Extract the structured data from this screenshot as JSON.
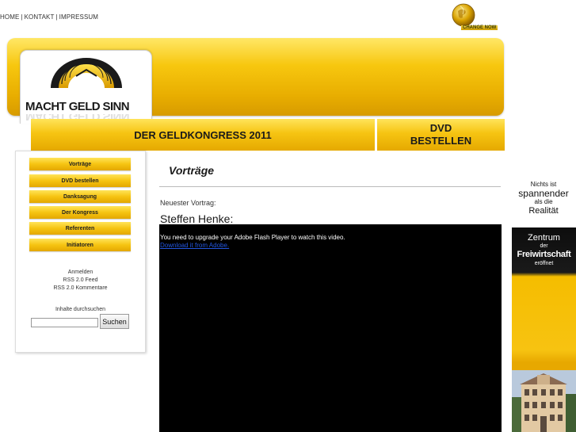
{
  "top_nav": {
    "items": [
      "HOME",
      "KONTAKT",
      "IMPRESSUM"
    ],
    "separator": "|"
  },
  "partner_logo": {
    "text": "CHANGE NOW",
    "icon": "globe-icon"
  },
  "site_logo": {
    "text": "MACHT GELD SINN",
    "icon": "rising-sun-logo-icon"
  },
  "header_bars": {
    "title": "DER GELDKONGRESS 2011",
    "dvd_line1": "DVD",
    "dvd_line2": "BESTELLEN"
  },
  "sidebar": {
    "menu": [
      "Vorträge",
      "DVD bestellen",
      "Danksagung",
      "Der Kongress",
      "Referenten",
      "Initiatoren"
    ],
    "links": [
      "Anmelden",
      "RSS 2.0 Feed",
      "RSS 2.0 Kommentare"
    ],
    "search_label": "Inhalte durchsuchen",
    "search_value": "",
    "search_button": "Suchen"
  },
  "content": {
    "title": "Vorträge",
    "latest_label": "Neuester Vortrag:",
    "speaker": "Steffen Henke:",
    "flash_message": "You need to upgrade your Adobe Flash Player to watch this video.",
    "flash_link": "Download it from Adobe."
  },
  "ads": {
    "ad1": {
      "line1": "Nichts ist",
      "line2": "spannender",
      "line3": "als die",
      "line4": "Realität"
    },
    "ad2": {
      "line1": "Zentrum",
      "line2": "der",
      "line3": "Freiwirtschaft",
      "line4": "eröffnet"
    }
  },
  "colors": {
    "accent": "#f6c412",
    "accent_dark": "#e3a700",
    "player_bg": "#000000"
  }
}
